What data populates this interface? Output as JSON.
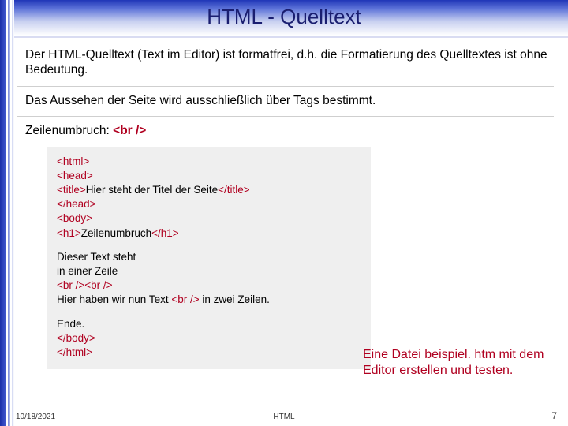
{
  "title": "HTML - Quelltext",
  "para1": "Der HTML-Quelltext (Text im Editor) ist formatfrei, d.h. die Formatierung des Quelltextes ist ohne Bedeutung.",
  "para2": "Das Aussehen der Seite wird ausschließlich über Tags bestimmt.",
  "zeilenLabel": "Zeilenumbruch:  ",
  "zeilenTag": "<br />",
  "code": {
    "l1a": "<html>",
    "l2a": "<head>",
    "l3a": "   <title>",
    "l3b": "Hier steht der Titel der Seite",
    "l3c": "</title>",
    "l4a": "</head>",
    "l5a": "<body>",
    "l6a": "<h1>",
    "l6b": "Zeilenumbruch",
    "l6c": "</h1>",
    "p2a": "Dieser Text steht",
    "p2b": "in einer Zeile",
    "p2c1": "<br /><br />",
    "p2d": "Hier haben wir nun Text ",
    "p2d2": "<br />",
    "p2e": " in zwei Zeilen.",
    "p3a": "Ende.",
    "p3b": "</body>",
    "p3c": "</html>"
  },
  "task": "Eine Datei beispiel. htm mit dem Editor erstellen und testen.",
  "footer": {
    "date": "10/18/2021",
    "mid": "HTML",
    "page": "7"
  }
}
